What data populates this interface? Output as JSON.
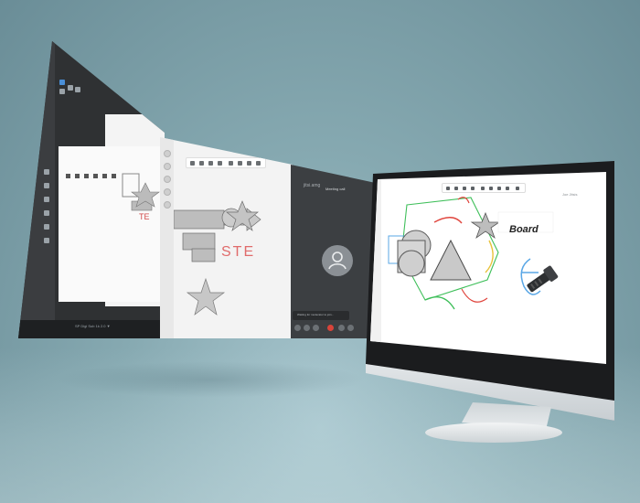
{
  "scene": {
    "description_colors": {
      "background": "#7fa2ab",
      "panel_dark": "#2f3133",
      "board": "#ffffff",
      "accent_blue": "#4a8fd8",
      "call_end": "#d9443a"
    }
  },
  "panel_left": {
    "status_text": "SP Digi  Sub 1k 2.0 ▼"
  },
  "panel_video": {
    "app_name": "jitsi.amg",
    "window_title": "Meeting call",
    "notification": "Waiting for moderator to join..."
  },
  "imac": {
    "board_label": "Board",
    "user_label": "Joe Jitsis"
  },
  "icons": [
    "pencil-icon",
    "eraser-icon",
    "shape-icon",
    "text-icon",
    "undo-icon",
    "user-icon",
    "flashlight-icon",
    "star-icon"
  ]
}
